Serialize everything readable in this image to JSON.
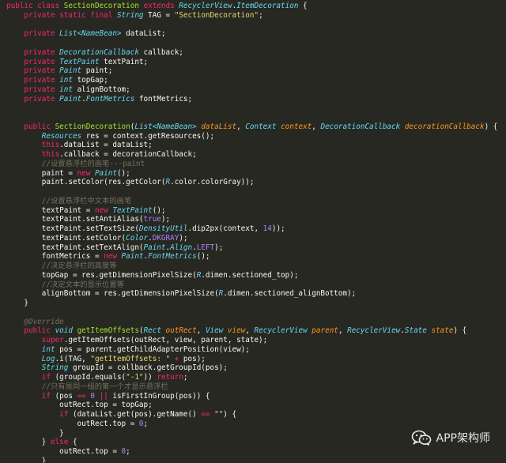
{
  "theme": {
    "background": "#272822",
    "keyword": "#f92672",
    "type": "#66d9ef",
    "function": "#a6e22e",
    "string": "#e6db74",
    "number": "#ae81ff",
    "comment": "#75715e",
    "parameter": "#fd971f",
    "plain": "#f8f8f2"
  },
  "lines": [
    [
      [
        "kw",
        "public class "
      ],
      [
        "fn",
        "SectionDecoration "
      ],
      [
        "kw",
        "extends "
      ],
      [
        "typ",
        "RecyclerView"
      ],
      [
        "txt",
        "."
      ],
      [
        "typ",
        "ItemDecoration"
      ],
      [
        "txt",
        " {"
      ]
    ],
    [
      [
        "txt",
        "    "
      ],
      [
        "kw",
        "private static final "
      ],
      [
        "typ",
        "String"
      ],
      [
        "txt",
        " TAG = "
      ],
      [
        "str",
        "\"SectionDecoration\""
      ],
      [
        "txt",
        ";"
      ]
    ],
    [],
    [
      [
        "txt",
        "    "
      ],
      [
        "kw",
        "private "
      ],
      [
        "typ",
        "List<NameBean>"
      ],
      [
        "txt",
        " dataList;"
      ]
    ],
    [],
    [
      [
        "txt",
        "    "
      ],
      [
        "kw",
        "private "
      ],
      [
        "typ",
        "DecorationCallback"
      ],
      [
        "txt",
        " callback;"
      ]
    ],
    [
      [
        "txt",
        "    "
      ],
      [
        "kw",
        "private "
      ],
      [
        "typ",
        "TextPaint"
      ],
      [
        "txt",
        " textPaint;"
      ]
    ],
    [
      [
        "txt",
        "    "
      ],
      [
        "kw",
        "private "
      ],
      [
        "typ",
        "Paint"
      ],
      [
        "txt",
        " paint;"
      ]
    ],
    [
      [
        "txt",
        "    "
      ],
      [
        "kw",
        "private "
      ],
      [
        "typ",
        "int"
      ],
      [
        "txt",
        " topGap;"
      ]
    ],
    [
      [
        "txt",
        "    "
      ],
      [
        "kw",
        "private "
      ],
      [
        "typ",
        "int"
      ],
      [
        "txt",
        " alignBottom;"
      ]
    ],
    [
      [
        "txt",
        "    "
      ],
      [
        "kw",
        "private "
      ],
      [
        "typ",
        "Paint"
      ],
      [
        "txt",
        "."
      ],
      [
        "typ",
        "FontMetrics"
      ],
      [
        "txt",
        " fontMetrics;"
      ]
    ],
    [],
    [],
    [
      [
        "txt",
        "    "
      ],
      [
        "kw",
        "public "
      ],
      [
        "fn",
        "SectionDecoration"
      ],
      [
        "txt",
        "("
      ],
      [
        "typ",
        "List<NameBean>"
      ],
      [
        "par",
        " dataList"
      ],
      [
        "txt",
        ", "
      ],
      [
        "typ",
        "Context"
      ],
      [
        "par",
        " context"
      ],
      [
        "txt",
        ", "
      ],
      [
        "typ",
        "DecorationCallback"
      ],
      [
        "par",
        " decorationCallback"
      ],
      [
        "txt",
        ") {"
      ]
    ],
    [
      [
        "txt",
        "        "
      ],
      [
        "typ",
        "Resources"
      ],
      [
        "txt",
        " res = context.getResources();"
      ]
    ],
    [
      [
        "txt",
        "        "
      ],
      [
        "kw",
        "this"
      ],
      [
        "txt",
        ".dataList = dataList;"
      ]
    ],
    [
      [
        "txt",
        "        "
      ],
      [
        "kw",
        "this"
      ],
      [
        "txt",
        ".callback = decorationCallback;"
      ]
    ],
    [
      [
        "txt",
        "        "
      ],
      [
        "com",
        "//设置悬浮栏的画笔---paint"
      ]
    ],
    [
      [
        "txt",
        "        paint = "
      ],
      [
        "kw",
        "new "
      ],
      [
        "typ",
        "Paint"
      ],
      [
        "txt",
        "();"
      ]
    ],
    [
      [
        "txt",
        "        paint.setColor(res.getColor("
      ],
      [
        "typ",
        "R"
      ],
      [
        "txt",
        ".color.colorGray));"
      ]
    ],
    [],
    [
      [
        "txt",
        "        "
      ],
      [
        "com",
        "//设置悬浮栏中文本的画笔"
      ]
    ],
    [
      [
        "txt",
        "        textPaint = "
      ],
      [
        "kw",
        "new "
      ],
      [
        "typ",
        "TextPaint"
      ],
      [
        "txt",
        "();"
      ]
    ],
    [
      [
        "txt",
        "        textPaint.setAntiAlias("
      ],
      [
        "cst",
        "true"
      ],
      [
        "txt",
        ");"
      ]
    ],
    [
      [
        "txt",
        "        textPaint.setTextSize("
      ],
      [
        "typ",
        "DensityUtil"
      ],
      [
        "txt",
        ".dip2px(context, "
      ],
      [
        "num",
        "14"
      ],
      [
        "txt",
        "));"
      ]
    ],
    [
      [
        "txt",
        "        textPaint.setColor("
      ],
      [
        "typ",
        "Color"
      ],
      [
        "txt",
        "."
      ],
      [
        "cst",
        "DKGRAY"
      ],
      [
        "txt",
        ");"
      ]
    ],
    [
      [
        "txt",
        "        textPaint.setTextAlign("
      ],
      [
        "typ",
        "Paint"
      ],
      [
        "txt",
        "."
      ],
      [
        "typ",
        "Align"
      ],
      [
        "txt",
        "."
      ],
      [
        "cst",
        "LEFT"
      ],
      [
        "txt",
        ");"
      ]
    ],
    [
      [
        "txt",
        "        fontMetrics = "
      ],
      [
        "kw",
        "new "
      ],
      [
        "typ",
        "Paint"
      ],
      [
        "txt",
        "."
      ],
      [
        "typ",
        "FontMetrics"
      ],
      [
        "txt",
        "();"
      ]
    ],
    [
      [
        "txt",
        "        "
      ],
      [
        "com",
        "//决定悬浮栏的高度等"
      ]
    ],
    [
      [
        "txt",
        "        topGap = res.getDimensionPixelSize("
      ],
      [
        "typ",
        "R"
      ],
      [
        "txt",
        ".dimen.sectioned_top);"
      ]
    ],
    [
      [
        "txt",
        "        "
      ],
      [
        "com",
        "//决定文本的显示位置等"
      ]
    ],
    [
      [
        "txt",
        "        alignBottom = res.getDimensionPixelSize("
      ],
      [
        "typ",
        "R"
      ],
      [
        "txt",
        ".dimen.sectioned_alignBottom);"
      ]
    ],
    [
      [
        "txt",
        "    }"
      ]
    ],
    [],
    [
      [
        "txt",
        "    "
      ],
      [
        "ann",
        "@Override"
      ]
    ],
    [
      [
        "txt",
        "    "
      ],
      [
        "kw",
        "public "
      ],
      [
        "typ",
        "void "
      ],
      [
        "fn",
        "getItemOffsets"
      ],
      [
        "txt",
        "("
      ],
      [
        "typ",
        "Rect"
      ],
      [
        "par",
        " outRect"
      ],
      [
        "txt",
        ", "
      ],
      [
        "typ",
        "View"
      ],
      [
        "par",
        " view"
      ],
      [
        "txt",
        ", "
      ],
      [
        "typ",
        "RecyclerView"
      ],
      [
        "par",
        " parent"
      ],
      [
        "txt",
        ", "
      ],
      [
        "typ",
        "RecyclerView"
      ],
      [
        "txt",
        "."
      ],
      [
        "typ",
        "State"
      ],
      [
        "par",
        " state"
      ],
      [
        "txt",
        ") {"
      ]
    ],
    [
      [
        "txt",
        "        "
      ],
      [
        "kw",
        "super"
      ],
      [
        "txt",
        ".getItemOffsets(outRect, view, parent, state);"
      ]
    ],
    [
      [
        "txt",
        "        "
      ],
      [
        "typ",
        "int"
      ],
      [
        "txt",
        " pos = parent.getChildAdapterPosition(view);"
      ]
    ],
    [
      [
        "txt",
        "        "
      ],
      [
        "typ",
        "Log"
      ],
      [
        "txt",
        ".i(TAG, "
      ],
      [
        "str",
        "\"getItemOffsets: \""
      ],
      [
        "kw",
        " + "
      ],
      [
        "txt",
        "pos);"
      ]
    ],
    [
      [
        "txt",
        "        "
      ],
      [
        "typ",
        "String"
      ],
      [
        "txt",
        " groupId = callback.getGroupId(pos);"
      ]
    ],
    [
      [
        "txt",
        "        "
      ],
      [
        "kw",
        "if "
      ],
      [
        "txt",
        "(groupId.equals("
      ],
      [
        "str",
        "\"-1\""
      ],
      [
        "txt",
        ")) "
      ],
      [
        "kw",
        "return"
      ],
      [
        "txt",
        ";"
      ]
    ],
    [
      [
        "txt",
        "        "
      ],
      [
        "com",
        "//只有是同一组的第一个才显示悬浮栏"
      ]
    ],
    [
      [
        "txt",
        "        "
      ],
      [
        "kw",
        "if "
      ],
      [
        "txt",
        "(pos "
      ],
      [
        "kw",
        "== "
      ],
      [
        "num",
        "0"
      ],
      [
        "kw",
        " || "
      ],
      [
        "txt",
        "isFirstInGroup(pos)) {"
      ]
    ],
    [
      [
        "txt",
        "            outRect.top = topGap;"
      ]
    ],
    [
      [
        "txt",
        "            "
      ],
      [
        "kw",
        "if "
      ],
      [
        "txt",
        "(dataList.get(pos).getName() "
      ],
      [
        "kw",
        "== "
      ],
      [
        "str",
        "\"\""
      ],
      [
        "txt",
        ") {"
      ]
    ],
    [
      [
        "txt",
        "                outRect.top = "
      ],
      [
        "num",
        "0"
      ],
      [
        "txt",
        ";"
      ]
    ],
    [
      [
        "txt",
        "            }"
      ]
    ],
    [
      [
        "txt",
        "        } "
      ],
      [
        "kw",
        "else "
      ],
      [
        "txt",
        "{"
      ]
    ],
    [
      [
        "txt",
        "            outRect.top = "
      ],
      [
        "num",
        "0"
      ],
      [
        "txt",
        ";"
      ]
    ],
    [
      [
        "txt",
        "        }"
      ]
    ],
    [
      [
        "txt",
        "    }"
      ]
    ]
  ],
  "watermark": {
    "icon": "wechat-icon",
    "text": "APP架构师"
  }
}
